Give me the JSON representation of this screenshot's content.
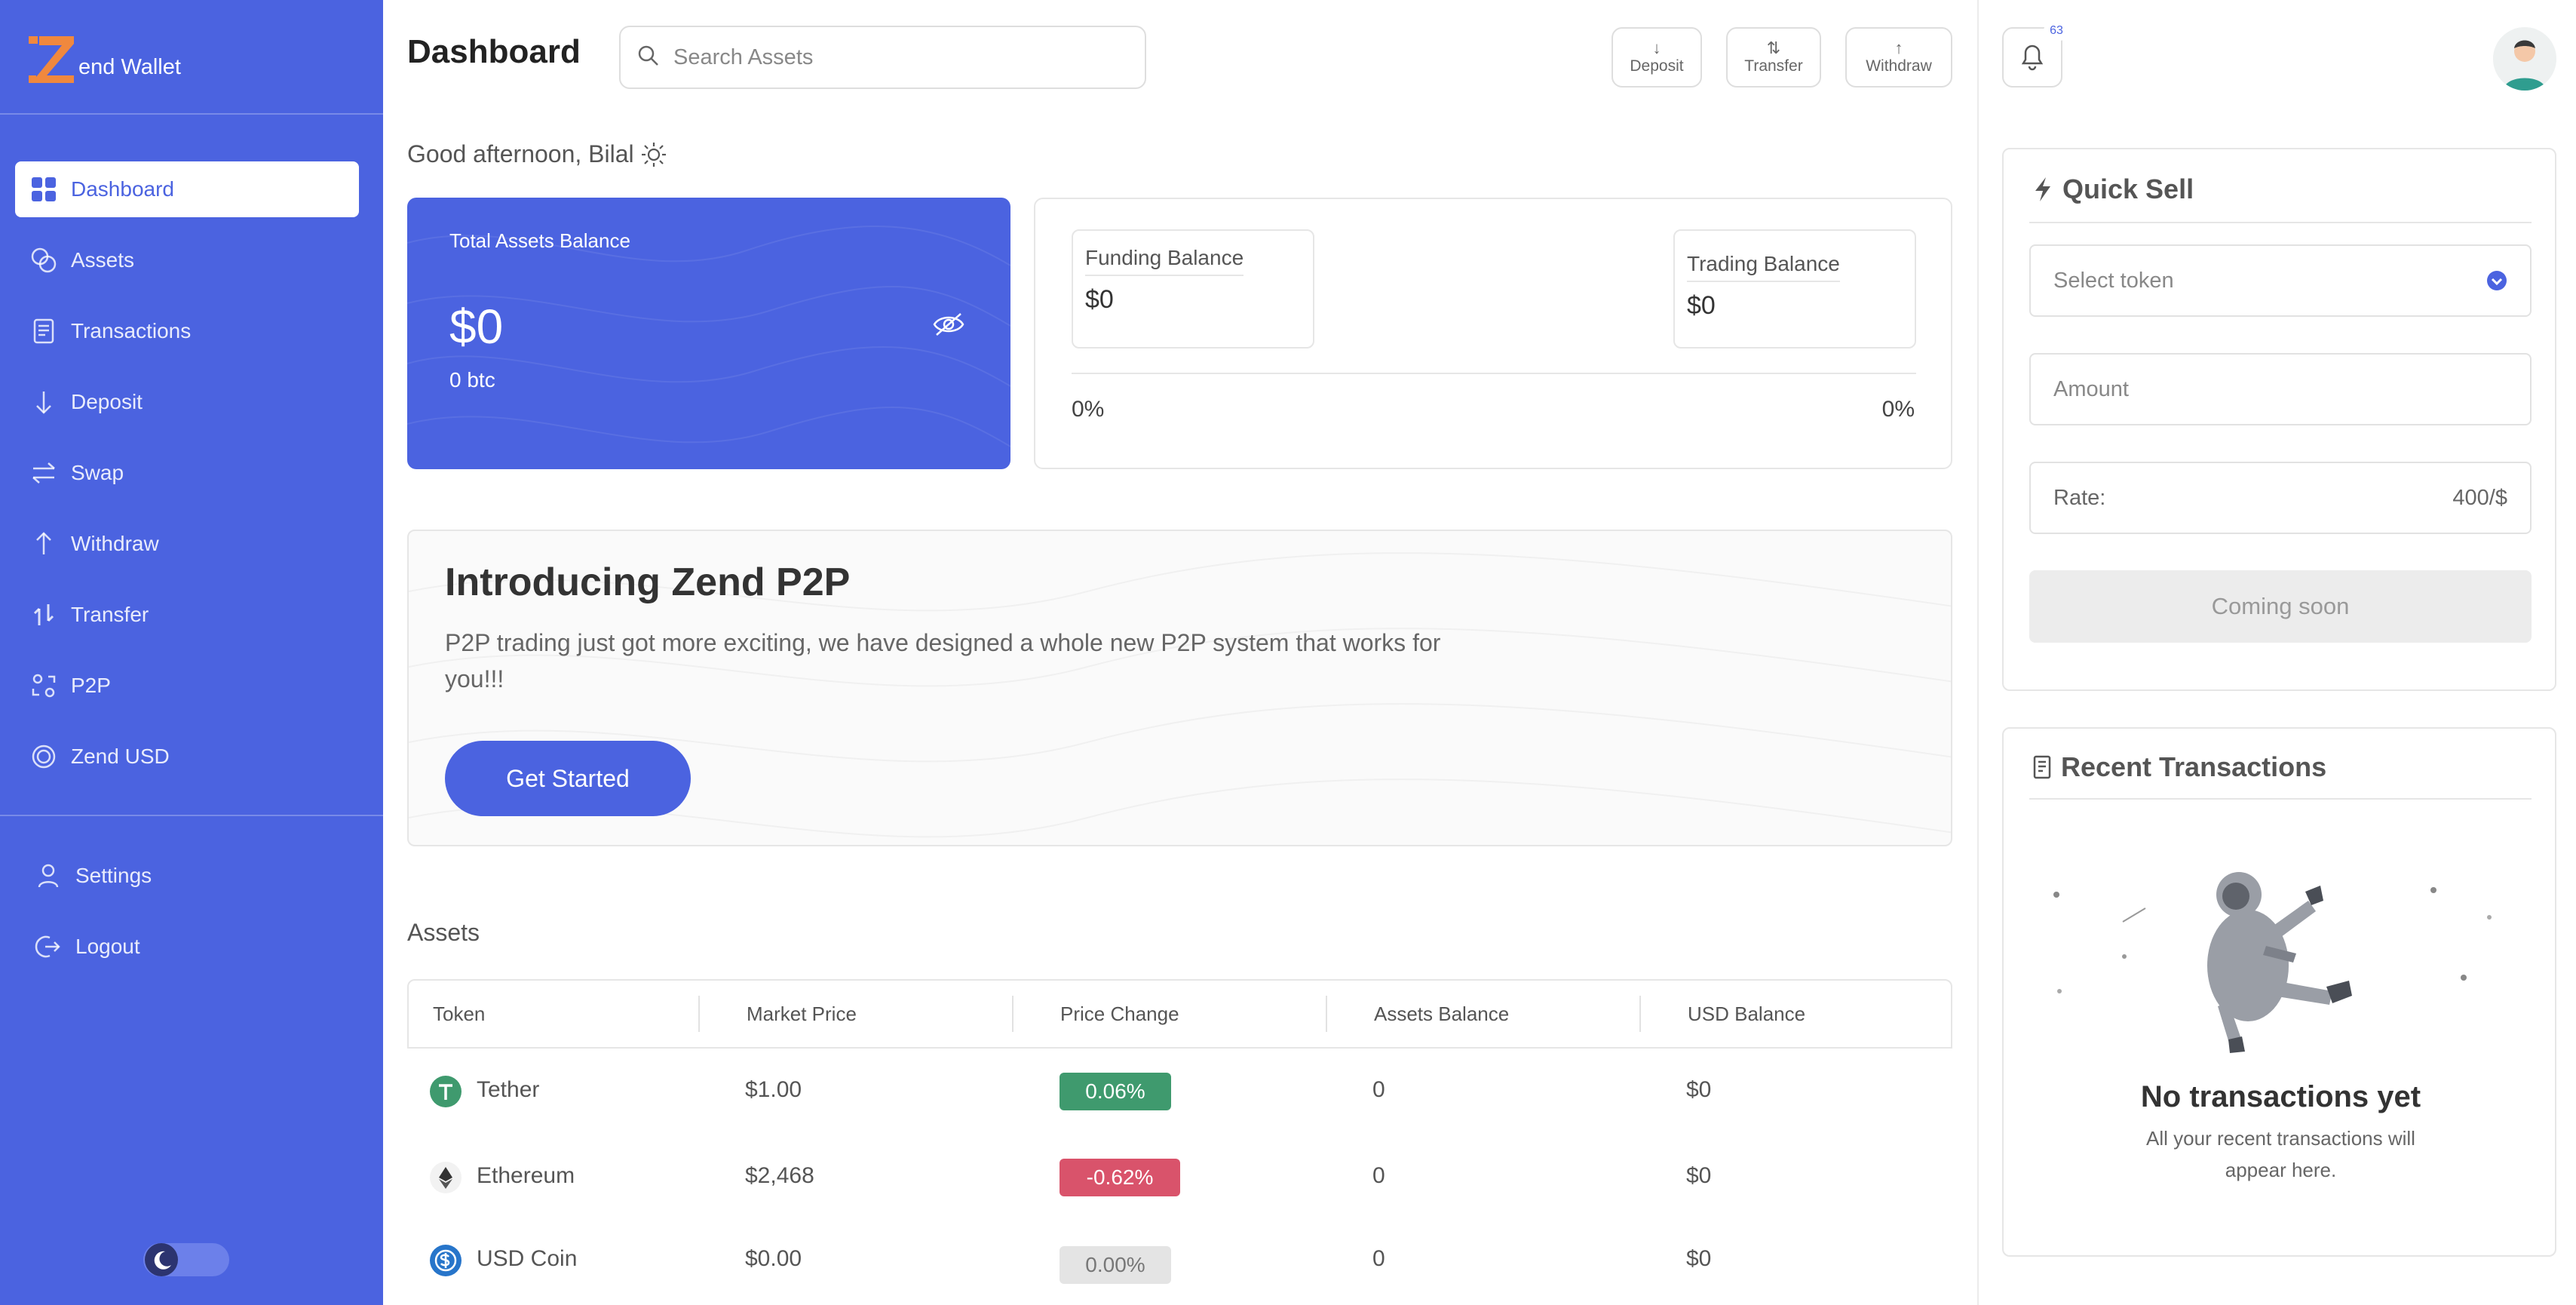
{
  "app": {
    "logo_letter": "Z",
    "logo_text": "end Wallet"
  },
  "sidebar": {
    "items": [
      {
        "label": "Dashboard",
        "icon": "grid-icon",
        "active": true
      },
      {
        "label": "Assets",
        "icon": "coins-icon"
      },
      {
        "label": "Transactions",
        "icon": "receipt-icon"
      },
      {
        "label": "Deposit",
        "icon": "arrow-down-icon"
      },
      {
        "label": "Swap",
        "icon": "swap-icon"
      },
      {
        "label": "Withdraw",
        "icon": "arrow-up-icon"
      },
      {
        "label": "Transfer",
        "icon": "transfer-icon"
      },
      {
        "label": "P2P",
        "icon": "p2p-icon"
      },
      {
        "label": "Zend USD",
        "icon": "coin-icon"
      }
    ],
    "bottom": [
      {
        "label": "Settings",
        "icon": "user-icon"
      },
      {
        "label": "Logout",
        "icon": "logout-icon"
      }
    ]
  },
  "header": {
    "title": "Dashboard",
    "search_placeholder": "Search Assets",
    "actions": [
      {
        "label": "Deposit",
        "icon": "arrow-down-icon"
      },
      {
        "label": "Transfer",
        "icon": "transfer-icon"
      },
      {
        "label": "Withdraw",
        "icon": "arrow-up-icon"
      }
    ],
    "notification_count": "63"
  },
  "greeting": "Good afternoon, Bilal",
  "balance": {
    "label": "Total Assets Balance",
    "amount": "$0",
    "btc": "0 btc"
  },
  "split": {
    "funding_label": "Funding Balance",
    "funding_value": "$0",
    "trading_label": "Trading Balance",
    "trading_value": "$0",
    "funding_pct": "0%",
    "trading_pct": "0%"
  },
  "promo": {
    "title": "Introducing Zend P2P",
    "body": "P2P trading just got more exciting, we have designed a whole new P2P system that works for you!!!",
    "cta": "Get Started"
  },
  "assets": {
    "title": "Assets",
    "columns": [
      "Token",
      "Market Price",
      "Price Change",
      "Assets Balance",
      "USD Balance"
    ],
    "rows": [
      {
        "token": "Tether",
        "price": "$1.00",
        "change": "0.06%",
        "change_color": "#3f9a6e",
        "balance": "0",
        "usd": "$0",
        "icon_color": "#3f9a6e"
      },
      {
        "token": "Ethereum",
        "price": "$2,468",
        "change": "-0.62%",
        "change_color": "#d9536b",
        "balance": "0",
        "usd": "$0",
        "icon_color": "#f2f2f2"
      },
      {
        "token": "USD Coin",
        "price": "$0.00",
        "change": "0.00%",
        "change_color": "#e4e4e4",
        "balance": "0",
        "usd": "$0",
        "icon_color": "#2775ca"
      }
    ]
  },
  "quick_sell": {
    "title": "Quick Sell",
    "token_placeholder": "Select token",
    "amount_placeholder": "Amount",
    "rate_label": "Rate:",
    "rate_value": "400/$",
    "button": "Coming soon"
  },
  "recent": {
    "title": "Recent Transactions",
    "empty_title": "No transactions yet",
    "empty_sub": "All your recent transactions will appear here."
  },
  "colors": {
    "brand": "#4b63e0",
    "accent_orange": "#f0883e",
    "positive": "#3f9a6e",
    "negative": "#d9536b"
  }
}
